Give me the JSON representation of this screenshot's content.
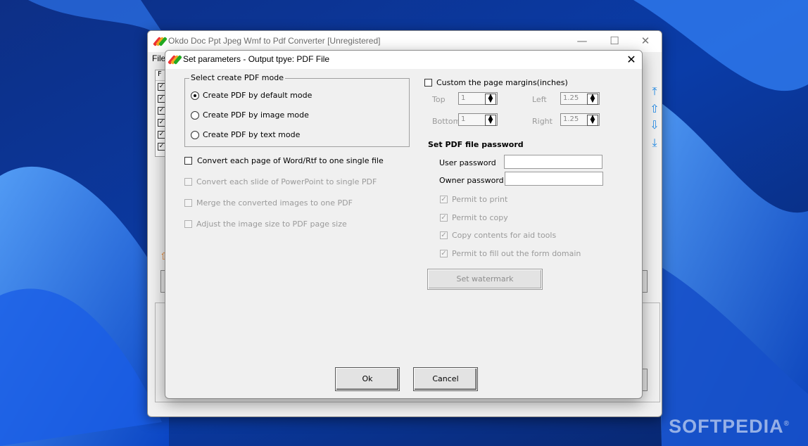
{
  "main_window": {
    "title": "Okdo Doc Ppt Jpeg Wmf to Pdf Converter [Unregistered]",
    "menu_file": "File",
    "list_header": "F",
    "minimize": "—",
    "maximize": "☐",
    "close": "✕"
  },
  "dialog": {
    "title": "Set parameters - Output tpye: PDF File",
    "close": "✕",
    "mode_group": {
      "legend": "Select create PDF mode",
      "options": [
        "Create PDF by default mode",
        "Create PDF by image mode",
        "Create PDF by text mode"
      ],
      "selected": "Create PDF by default mode"
    },
    "options": {
      "word_single": "Convert each page of Word/Rtf to one single file",
      "ppt_single": "Convert each slide of PowerPoint to single PDF",
      "merge_images": "Merge the converted images to one PDF",
      "adjust_size": "Adjust the image size to PDF page size"
    },
    "margins": {
      "label": "Custom the page margins(inches)",
      "top_label": "Top",
      "top_value": "1",
      "bottom_label": "Bottom",
      "bottom_value": "1",
      "left_label": "Left",
      "left_value": "1.25",
      "right_label": "Right",
      "right_value": "1.25"
    },
    "password": {
      "heading": "Set PDF file password",
      "user_label": "User password",
      "owner_label": "Owner password",
      "user_value": "",
      "owner_value": ""
    },
    "permissions": {
      "print": "Permit to print",
      "copy": "Permit to copy",
      "aid_tools": "Copy contents for aid tools",
      "fill_form": "Permit to fill out the form domain"
    },
    "watermark_button": "Set watermark",
    "ok_button": "Ok",
    "cancel_button": "Cancel"
  },
  "watermark_brand": "SOFTPEDIA",
  "colors": {
    "desktop": "#0b2a78",
    "accent_arrow": "#1e88e5"
  }
}
